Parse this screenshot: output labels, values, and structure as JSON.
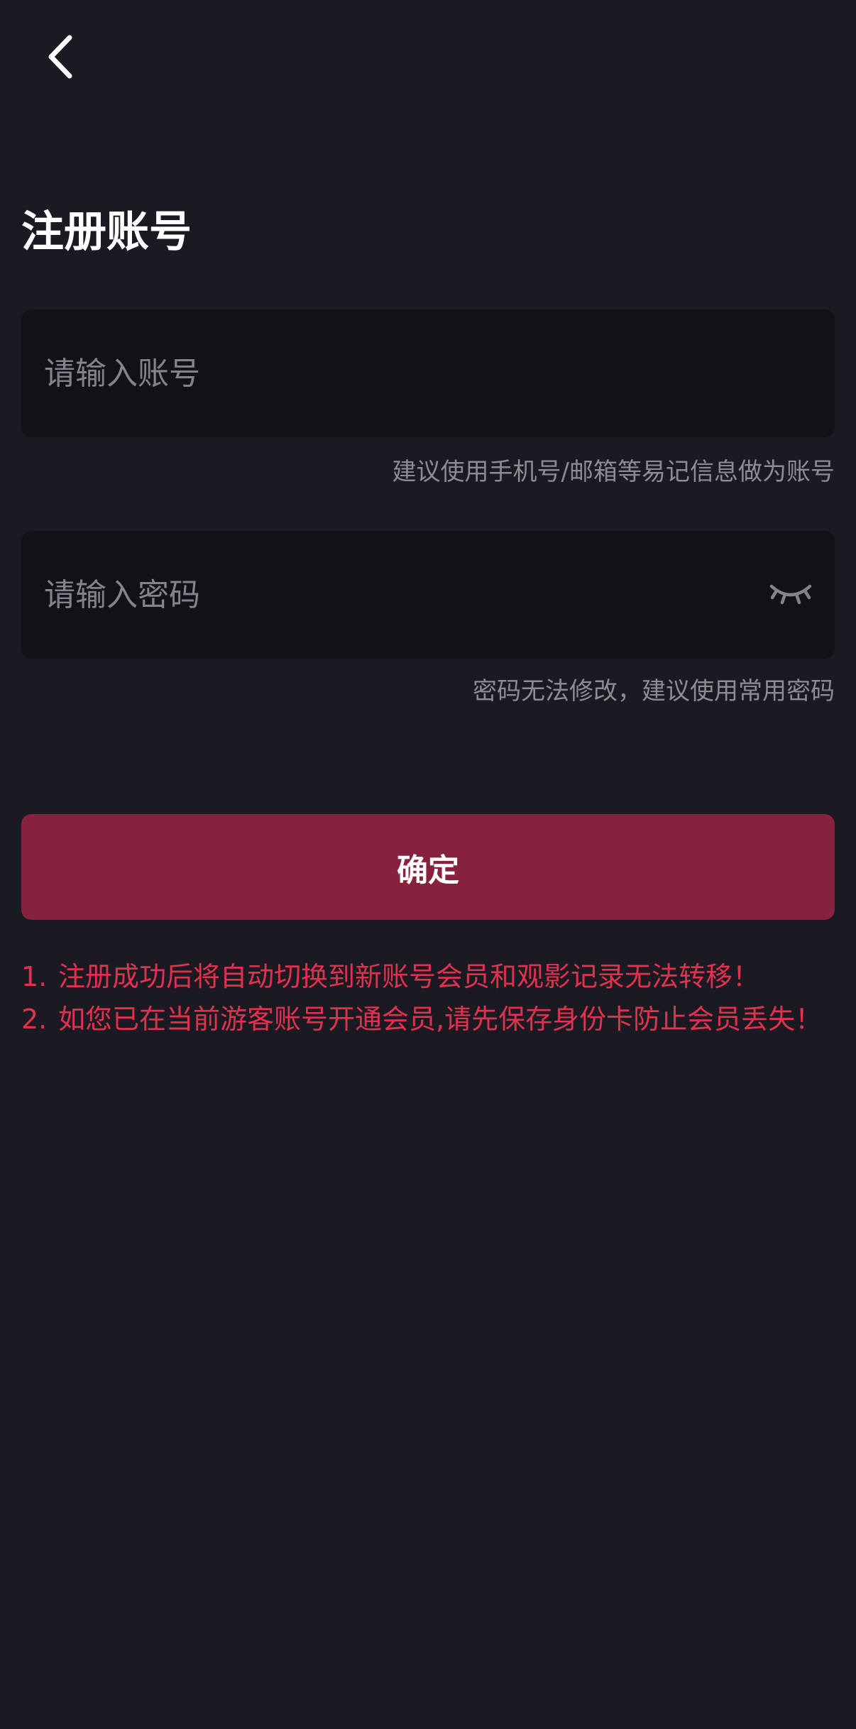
{
  "header": {
    "back_icon": "chevron-left-icon"
  },
  "page": {
    "title": "注册账号"
  },
  "account": {
    "placeholder": "请输入账号",
    "value": "",
    "hint": "建议使用手机号/邮箱等易记信息做为账号"
  },
  "password": {
    "placeholder": "请输入密码",
    "value": "",
    "toggle_icon": "eye-closed-icon",
    "hint": "密码无法修改，建议使用常用密码"
  },
  "confirm": {
    "label": "确定"
  },
  "notices": [
    {
      "num": "1.",
      "text": "注册成功后将自动切换到新账号会员和观影记录无法转移！"
    },
    {
      "num": "2.",
      "text": "如您已在当前游客账号开通会员,请先保存身份卡防止会员丢失！"
    }
  ],
  "colors": {
    "background": "#1b1922",
    "field_background": "#121118",
    "accent": "#86223d",
    "warning_text": "#e0324f",
    "hint_text": "#8d8c93"
  }
}
